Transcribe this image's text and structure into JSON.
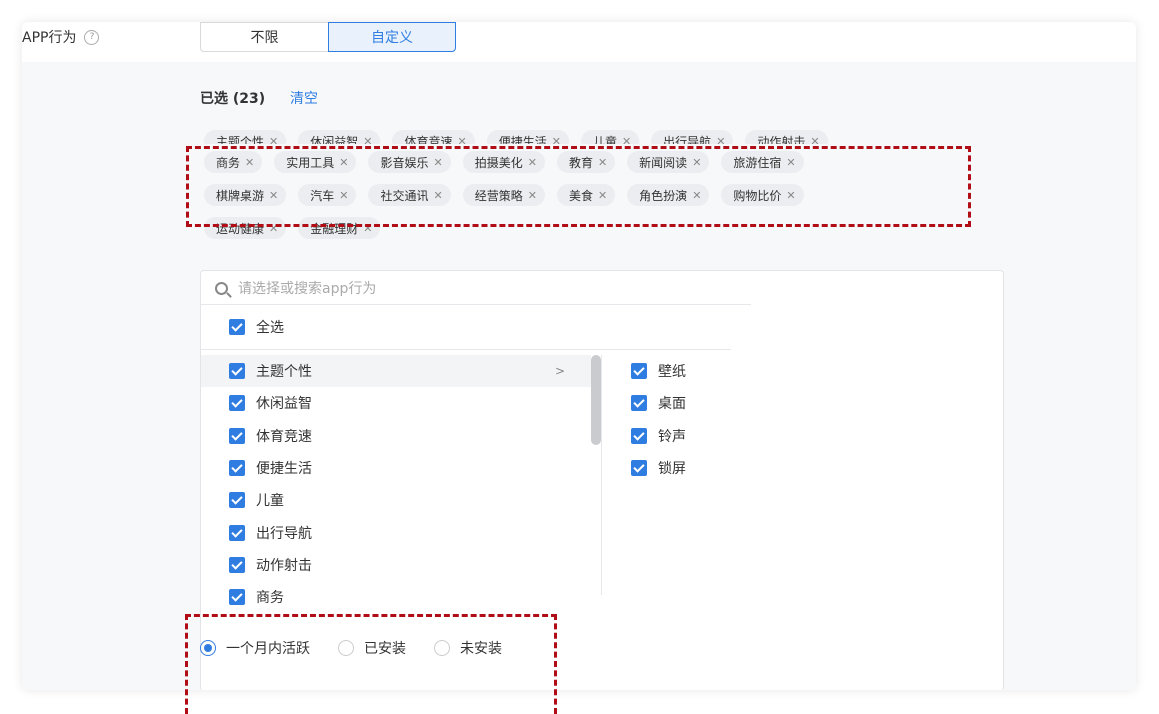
{
  "field": {
    "label": "APP行为",
    "help_icon": "?"
  },
  "segment": {
    "options": [
      "不限",
      "自定义"
    ],
    "active": "自定义"
  },
  "selected": {
    "title": "已选 (23)",
    "clear_label": "清空",
    "partial_row": [
      "主题个性",
      "休闲益智",
      "体育竞速",
      "便捷生活",
      "儿童",
      "出行导航",
      "动作射击"
    ],
    "row1": [
      "商务",
      "实用工具",
      "影音娱乐",
      "拍摄美化",
      "教育",
      "新闻阅读",
      "旅游住宿"
    ],
    "row2": [
      "棋牌桌游",
      "汽车",
      "社交通讯",
      "经营策略",
      "美食",
      "角色扮演",
      "购物比价"
    ],
    "row3": [
      "运动健康",
      "金融理财"
    ],
    "remove_glyph": "✕"
  },
  "dropdown": {
    "search_placeholder": "请选择或搜索app行为",
    "select_all_label": "全选",
    "left_items": [
      "主题个性",
      "休闲益智",
      "体育竞速",
      "便捷生活",
      "儿童",
      "出行导航",
      "动作射击",
      "商务"
    ],
    "chevron": ">",
    "right_items": [
      "壁纸",
      "桌面",
      "铃声",
      "锁屏"
    ]
  },
  "radios": {
    "options": [
      "一个月内活跃",
      "已安装",
      "未安装"
    ],
    "selected": "一个月内活跃"
  },
  "colors": {
    "accent": "#2f7de1",
    "annotation": "#b00d17",
    "tag_bg": "#ebedf0"
  }
}
